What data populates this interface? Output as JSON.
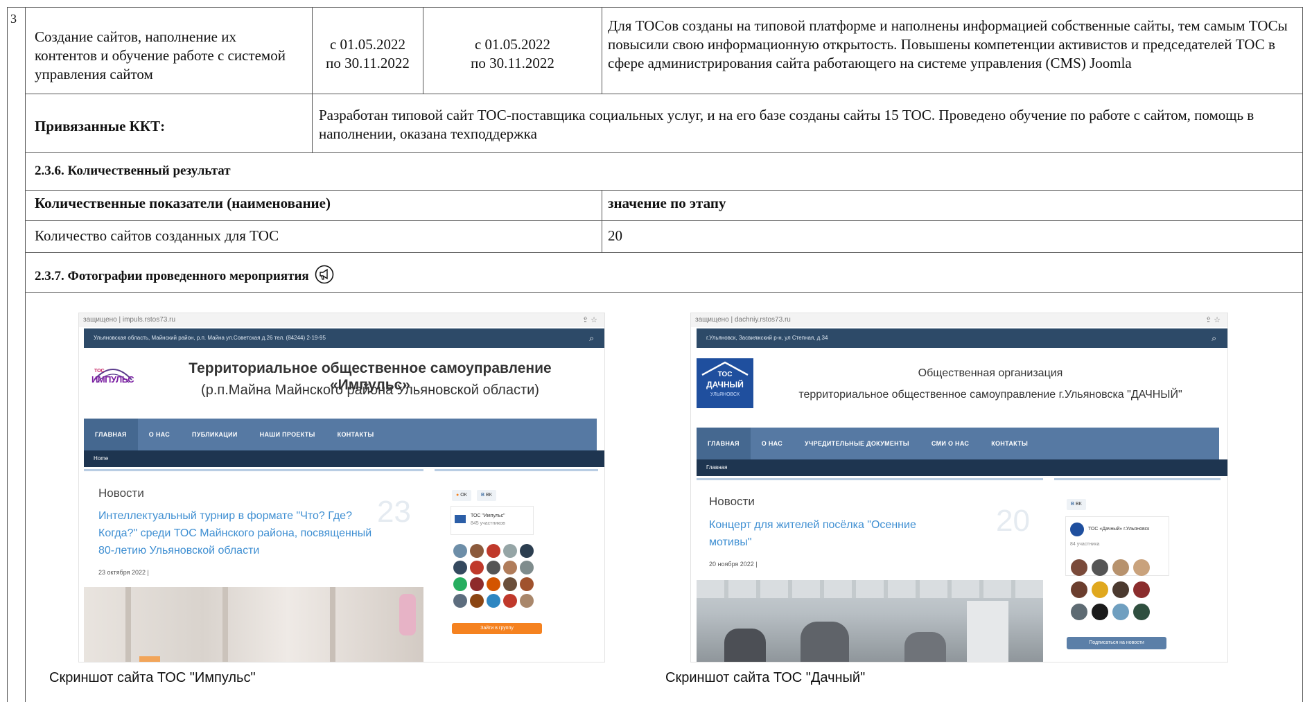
{
  "row": {
    "number": "3",
    "name": "Создание сайтов, наполнение их контентов и обучение работе с системой управления сайтом",
    "plan_from": "с 01.05.2022",
    "plan_to": "по 30.11.2022",
    "fact_from": "с 01.05.2022",
    "fact_to": "по 30.11.2022",
    "result": "Для ТОСов созданы на типовой платформе и наполнены информацией собственные сайты, тем самым ТОСы повысили свою информационную открытость. Повышены компетенции активистов и председателей ТОС в сфере администрирования сайта работающего на системе управления (CMS) Joomla"
  },
  "linked": {
    "label": "Привязанные ККТ:",
    "text": "Разработан типовой сайт ТОС-поставщика социальных услуг, и на его базе созданы сайты 15 ТОС. Проведено обучение по работе с сайтом, помощь в наполнении, оказана техподдержка"
  },
  "quant": {
    "heading": "2.3.6. Количественный результат",
    "col_name": "Количественные показатели (наименование)",
    "col_value": "значение по этапу",
    "row_name": "Количество сайтов созданных для ТОС",
    "row_value": "20"
  },
  "photos": {
    "heading": "2.3.7. Фотографии проведенного мероприятия",
    "heading_icon": "megaphone-icon",
    "left_caption": "Скриншот сайта ТОС \"Импульс\"",
    "right_caption": "Скриншот сайта ТОС \"Дачный\""
  },
  "shot_left": {
    "url": "защищено | impuls.rstos73.ru",
    "topline": "Ульяновская область, Майнский район, р.п. Майна ул.Советская д.26  тел. (84244) 2-19-95",
    "logo_small": "ТОС",
    "logo_big": "ИМПУЛЬС",
    "title": "Территориальное общественное самоуправление «Импульс»",
    "subtitle": "(р.п.Майна Майнского района Ульяновской области)",
    "nav": [
      "ГЛАВНАЯ",
      "О НАС",
      "ПУБЛИКАЦИИ",
      "НАШИ ПРОЕКТЫ",
      "КОНТАКТЫ"
    ],
    "crumb": "Home",
    "news_heading": "Новости",
    "news_title": "Интеллектуальный турнир в формате \"Что? Где? Когда?\" среди ТОС Майнского района, посвященный 80-летию Ульяновской области",
    "news_num": "23",
    "news_date": "23 октября 2022 |",
    "chip_ok": "ОК",
    "chip_vk": "ВК",
    "group_name": "ТОС \"Импульс\"",
    "group_members": "845 участников",
    "join": "Зайти в группу"
  },
  "shot_right": {
    "url": "защищено | dachniy.rstos73.ru",
    "topline": "г.Ульяновск, Засвияжский р-н, ул Степная, д.34",
    "logo_top": "ТОС",
    "logo_mid": "ДАЧНЫЙ",
    "logo_bottom": "УЛЬЯНОВСК",
    "title": "Общественная организация",
    "subtitle": "территориальное общественное самоуправление г.Ульяновска \"ДАЧНЫЙ\"",
    "nav": [
      "ГЛАВНАЯ",
      "О НАС",
      "УЧРЕДИТЕЛЬНЫЕ ДОКУМЕНТЫ",
      "СМИ О НАС",
      "КОНТАКТЫ"
    ],
    "crumb": "Главная",
    "news_heading": "Новости",
    "news_title": "Концерт для жителей посёлка \"Осенние мотивы\"",
    "news_num": "20",
    "news_date": "20 ноября 2022 |",
    "chip_vk": "ВК",
    "group_name": "ТОС «Дачный» г.Ульяновск",
    "group_members": "84 участника",
    "subscribe": "Подписаться на новости"
  }
}
